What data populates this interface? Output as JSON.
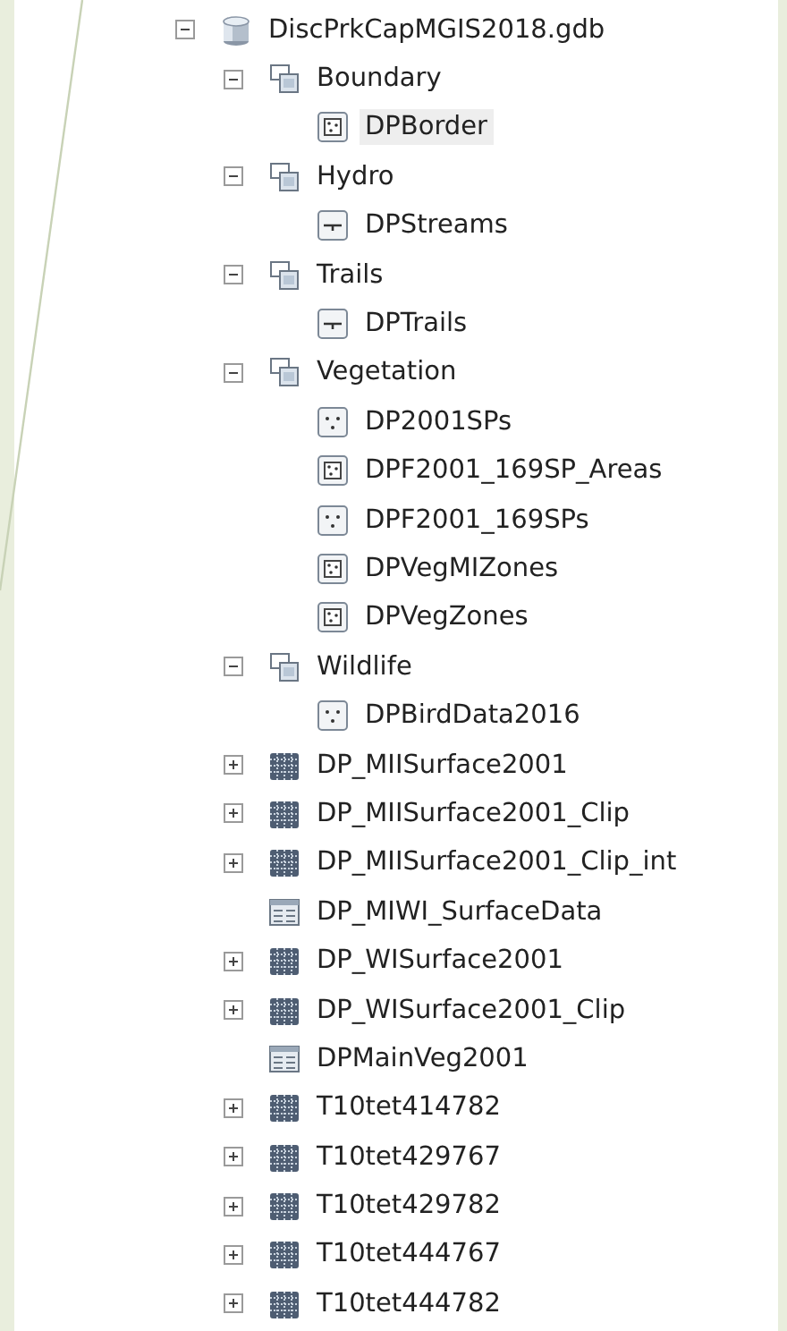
{
  "tree": [
    {
      "label": "DiscPrkCapMGIS2018.gdb",
      "kind": "geodatabase",
      "expanded": true,
      "selected": false,
      "children": [
        {
          "label": "Boundary",
          "kind": "dataset",
          "expanded": true,
          "selected": false,
          "children": [
            {
              "label": "DPBorder",
              "kind": "polygon",
              "selected": true
            }
          ]
        },
        {
          "label": "Hydro",
          "kind": "dataset",
          "expanded": true,
          "selected": false,
          "children": [
            {
              "label": "DPStreams",
              "kind": "line",
              "selected": false
            }
          ]
        },
        {
          "label": "Trails",
          "kind": "dataset",
          "expanded": true,
          "selected": false,
          "children": [
            {
              "label": "DPTrails",
              "kind": "line",
              "selected": false
            }
          ]
        },
        {
          "label": "Vegetation",
          "kind": "dataset",
          "expanded": true,
          "selected": false,
          "children": [
            {
              "label": "DP2001SPs",
              "kind": "point",
              "selected": false
            },
            {
              "label": "DPF2001_169SP_Areas",
              "kind": "polygon",
              "selected": false
            },
            {
              "label": "DPF2001_169SPs",
              "kind": "point",
              "selected": false
            },
            {
              "label": "DPVegMIZones",
              "kind": "polygon",
              "selected": false
            },
            {
              "label": "DPVegZones",
              "kind": "polygon",
              "selected": false
            }
          ]
        },
        {
          "label": "Wildlife",
          "kind": "dataset",
          "expanded": true,
          "selected": false,
          "children": [
            {
              "label": "DPBirdData2016",
              "kind": "point",
              "selected": false
            }
          ]
        },
        {
          "label": "DP_MIISurface2001",
          "kind": "raster",
          "expanded": false,
          "selected": false
        },
        {
          "label": "DP_MIISurface2001_Clip",
          "kind": "raster",
          "expanded": false,
          "selected": false
        },
        {
          "label": "DP_MIISurface2001_Clip_int",
          "kind": "raster",
          "expanded": false,
          "selected": false
        },
        {
          "label": "DP_MIWI_SurfaceData",
          "kind": "table",
          "selected": false
        },
        {
          "label": "DP_WISurface2001",
          "kind": "raster",
          "expanded": false,
          "selected": false
        },
        {
          "label": "DP_WISurface2001_Clip",
          "kind": "raster",
          "expanded": false,
          "selected": false
        },
        {
          "label": "DPMainVeg2001",
          "kind": "table",
          "selected": false
        },
        {
          "label": "T10tet414782",
          "kind": "raster",
          "expanded": false,
          "selected": false
        },
        {
          "label": "T10tet429767",
          "kind": "raster",
          "expanded": false,
          "selected": false
        },
        {
          "label": "T10tet429782",
          "kind": "raster",
          "expanded": false,
          "selected": false
        },
        {
          "label": "T10tet444767",
          "kind": "raster",
          "expanded": false,
          "selected": false
        },
        {
          "label": "T10tet444782",
          "kind": "raster",
          "expanded": false,
          "selected": false
        }
      ]
    }
  ]
}
